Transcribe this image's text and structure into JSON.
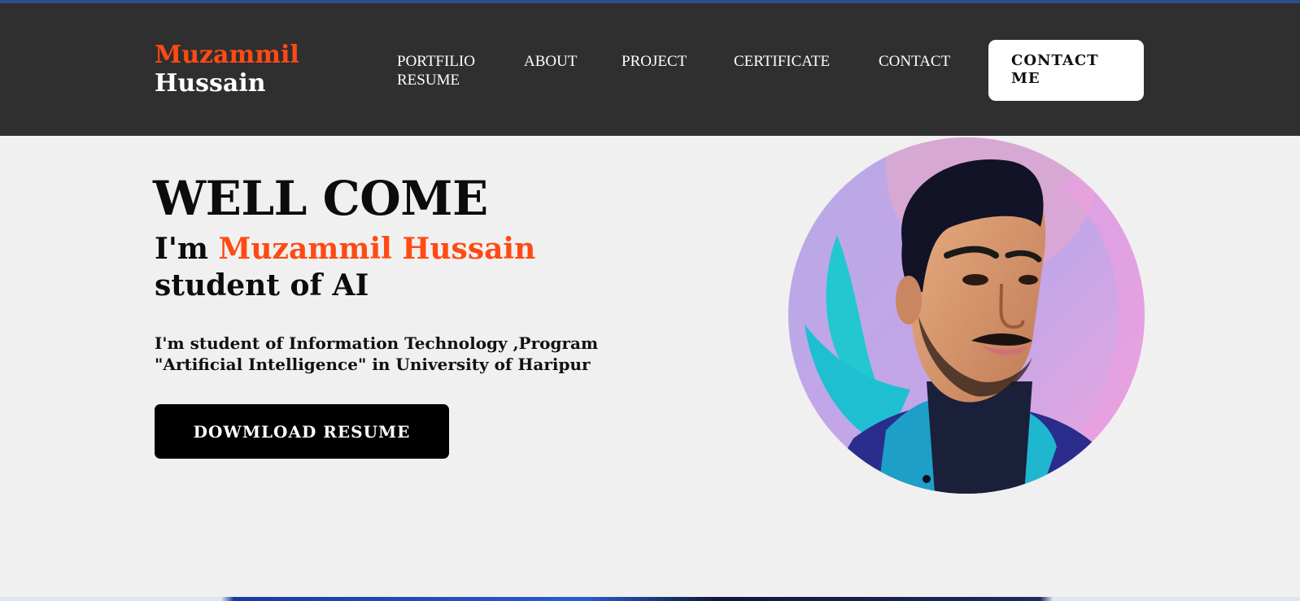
{
  "navbar": {
    "logo_first": "Muzammil",
    "logo_last": "Hussain",
    "links": [
      "PORTFILIO RESUME",
      "ABOUT",
      "PROJECT",
      "CERTIFICATE",
      "CONTACT"
    ],
    "contact_button": "CONTACT ME"
  },
  "hero": {
    "title": "WELL COME",
    "intro_prefix": "I'm ",
    "intro_name": "Muzammil Hussain",
    "role": "student of AI",
    "description_line1": "I'm student of Information Technology ,Program",
    "description_line2": "\"Artificial Intelligence\" in University of Haripur",
    "download_button": "DOWMLOAD RESUME"
  },
  "colors": {
    "navbar_bg": "#2f2f2f",
    "accent": "#ff4a14",
    "page_bg": "#f0f0f0",
    "button_dark": "#000000",
    "button_light": "#ffffff"
  }
}
